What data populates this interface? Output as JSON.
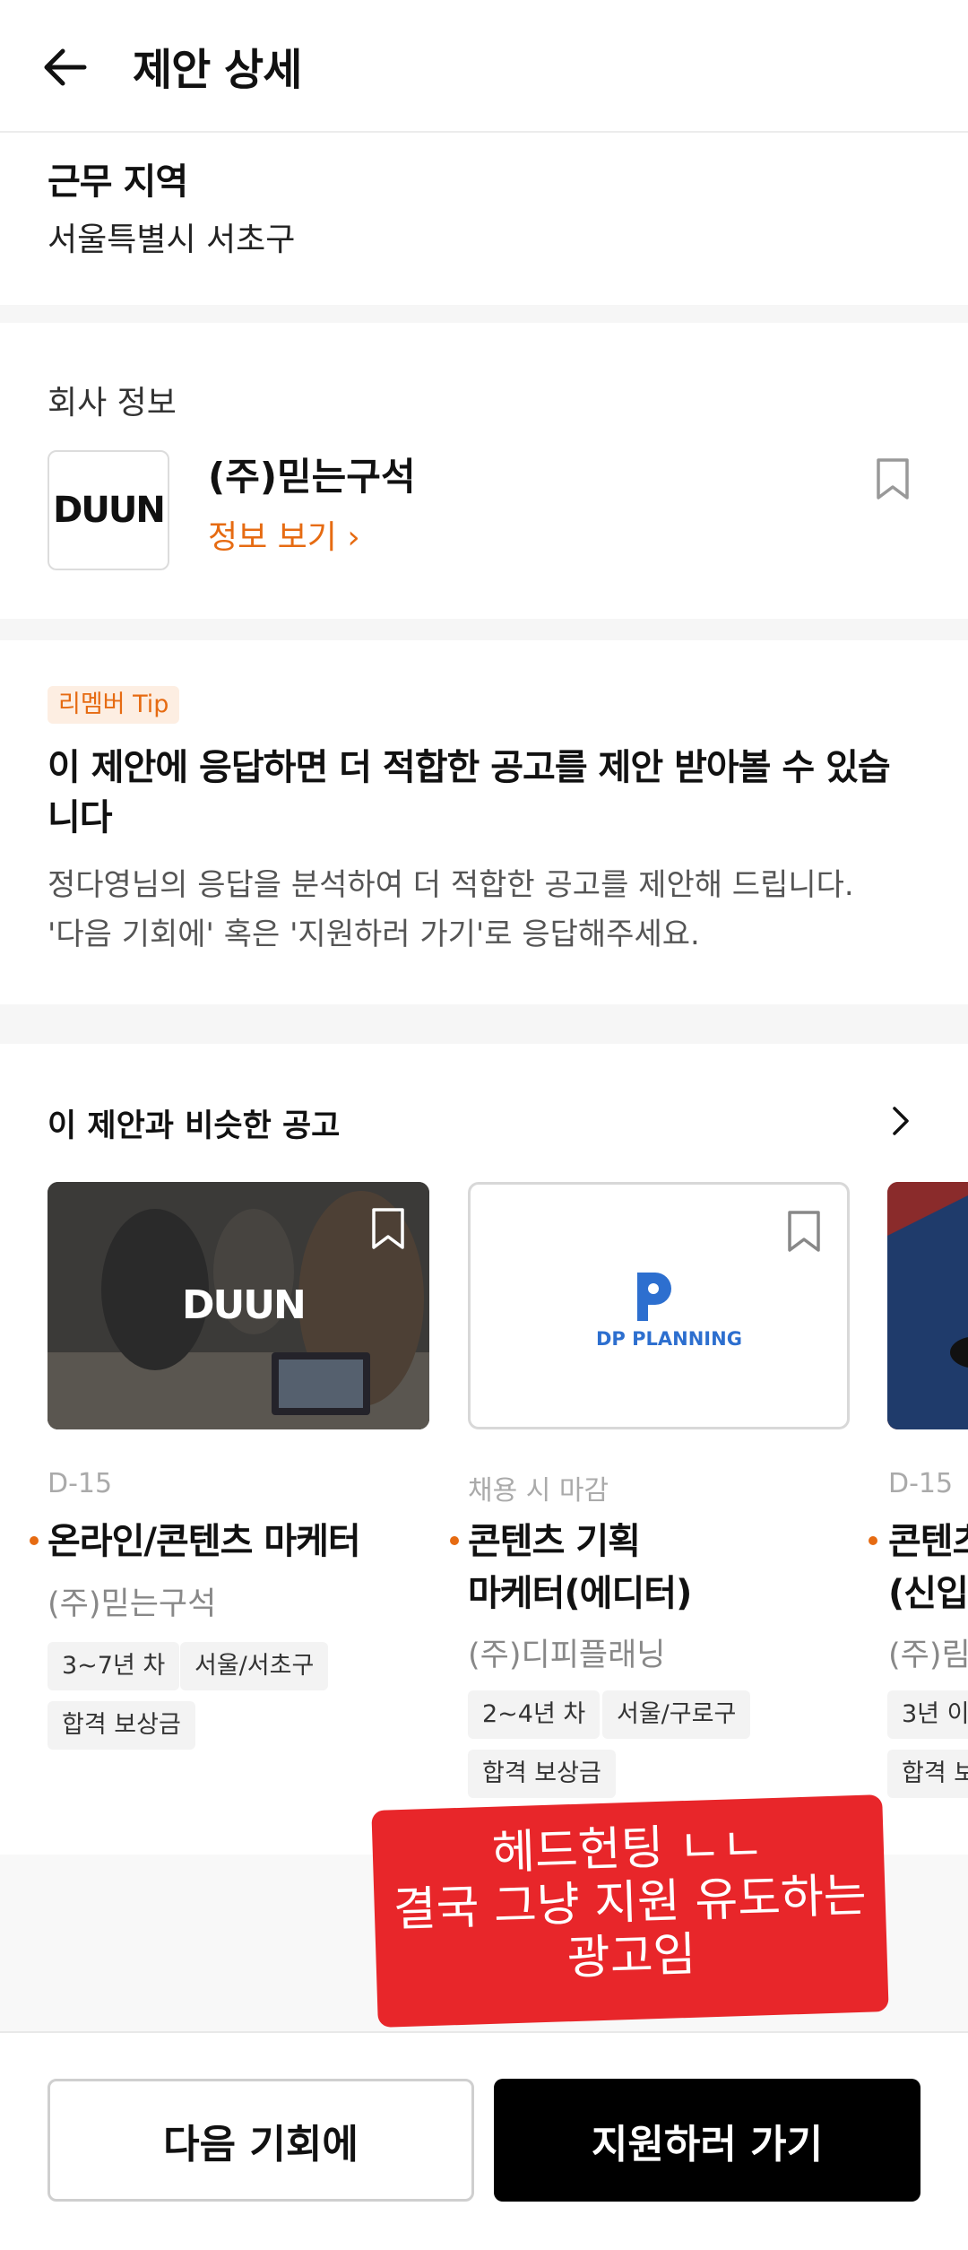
{
  "header": {
    "title": "제안 상세",
    "back_icon": "arrow-left-icon"
  },
  "work_area": {
    "title": "근무 지역",
    "value": "서울특별시 서초구"
  },
  "company": {
    "section_label": "회사 정보",
    "logo_text": "DUUN",
    "name": "(주)믿는구석",
    "info_link": "정보 보기 ›",
    "bookmark_icon": "bookmark-icon"
  },
  "tip": {
    "badge": "리멤버 Tip",
    "title": "이 제안에 응답하면 더 적합한 공고를 제안 받아볼 수 있습니다",
    "desc_line1": "정다영님의 응답을 분석하여 더 적합한 공고를 제안해 드립니다.",
    "desc_line2": "'다음 기회에' 혹은 '지원하러 가기'로 응답해주세요."
  },
  "similar": {
    "title": "이 제안과 비슷한 공고",
    "more_icon": "chevron-right-icon",
    "jobs": [
      {
        "dday": "D-15",
        "title": "온라인/콘텐츠 마케터",
        "company": "(주)믿는구석",
        "logo_text": "DUUN",
        "tags": [
          "3~7년 차",
          "서울/서초구",
          "합격 보상금"
        ]
      },
      {
        "dday": "채용 시 마감",
        "title_line1": "콘텐츠 기획",
        "title_line2": "마케터(에디터)",
        "company": "(주)디피플래닝",
        "logo_text": "DP PLANNING",
        "tags": [
          "2~4년 차",
          "서울/구로구",
          "합격 보상금"
        ]
      },
      {
        "dday": "D-15",
        "title_line1": "콘텐츠",
        "title_line2": "(신입",
        "company": "(주)림",
        "tags": [
          "3년 이",
          "합격 보"
        ]
      }
    ]
  },
  "sticker": {
    "line1": "헤드헌팅 ㄴㄴ",
    "line2": "결국 그냥 지원 유도하는",
    "line3": "광고임"
  },
  "actions": {
    "next_label": "다음 기회에",
    "apply_label": "지원하러 가기"
  },
  "colors": {
    "accent": "#e66b12",
    "sticker": "#e8262a",
    "primary_button": "#000000"
  }
}
